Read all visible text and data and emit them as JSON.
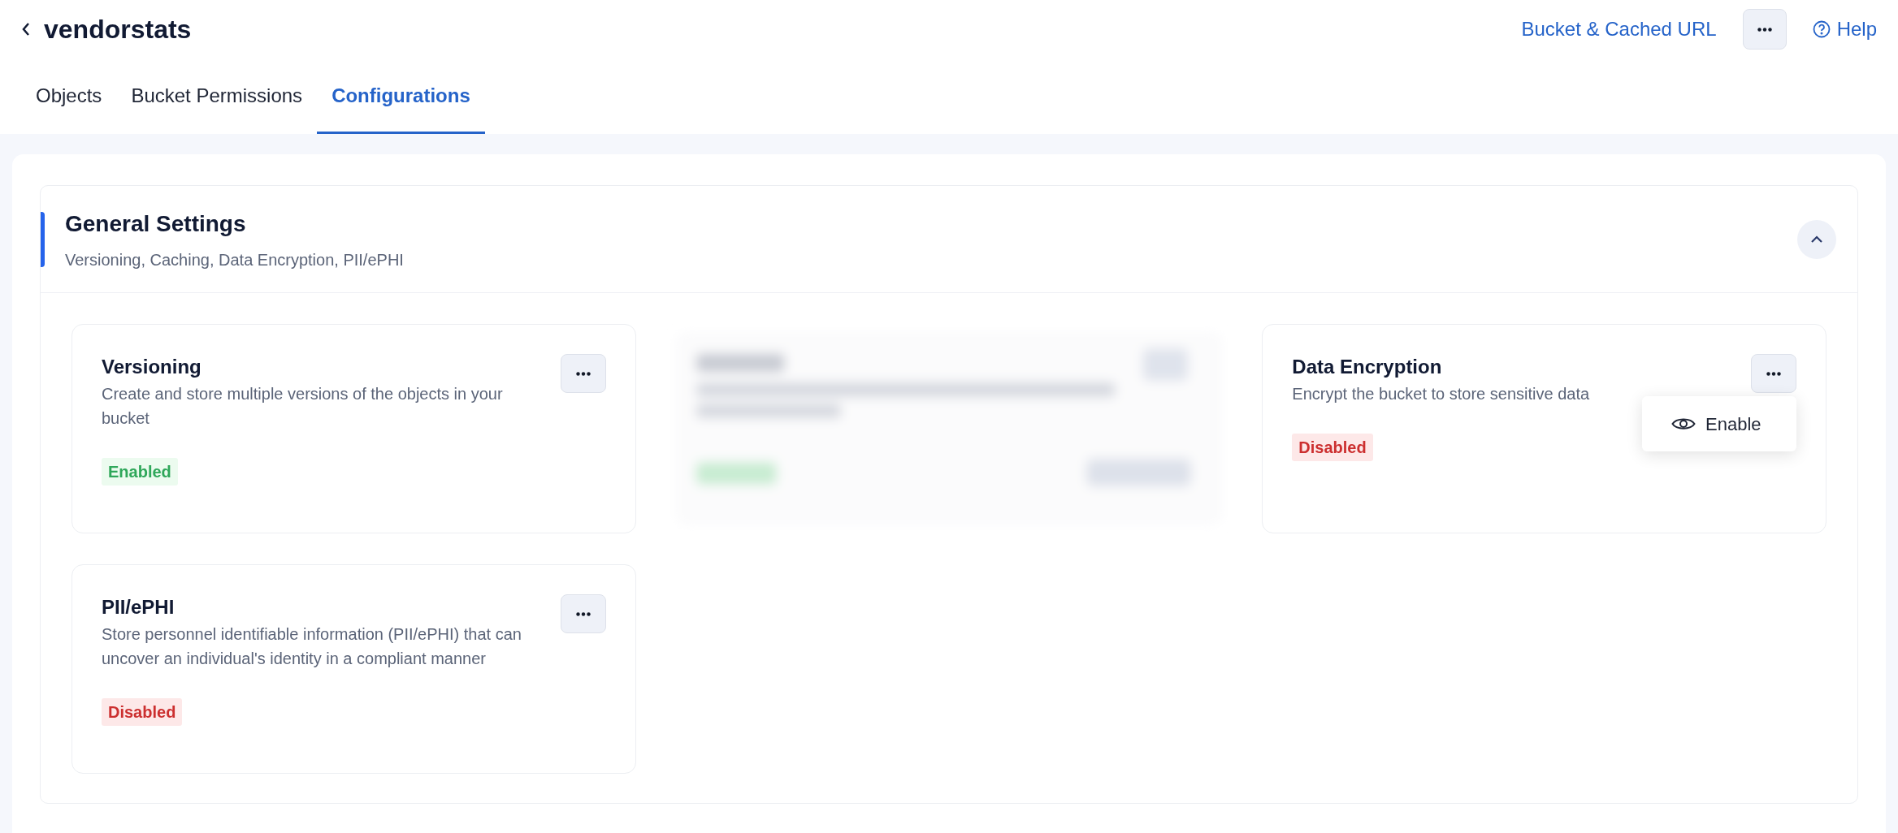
{
  "header": {
    "title": "vendorstats",
    "link": "Bucket & Cached URL",
    "help": "Help"
  },
  "tabs": [
    {
      "label": "Objects",
      "selected": false
    },
    {
      "label": "Bucket Permissions",
      "selected": false
    },
    {
      "label": "Configurations",
      "selected": true
    }
  ],
  "section": {
    "title": "General Settings",
    "subtitle": "Versioning, Caching, Data Encryption, PII/ePHI",
    "expanded": true,
    "cards": [
      {
        "kind": "setting",
        "title": "Versioning",
        "description": "Create and store multiple versions of the objects in your bucket",
        "status": {
          "label": "Enabled",
          "enabled": true
        }
      },
      {
        "kind": "blurred"
      },
      {
        "kind": "setting",
        "title": "Data Encryption",
        "description": "Encrypt the bucket to store sensitive data",
        "status": {
          "label": "Disabled",
          "enabled": false
        },
        "menu": [
          {
            "label": "Enable"
          }
        ]
      },
      {
        "kind": "setting",
        "title": "PII/ePHI",
        "description": "Store personnel identifiable information (PII/ePHI) that can uncover an individual's identity in a compliant manner",
        "status": {
          "label": "Disabled",
          "enabled": false
        }
      }
    ]
  }
}
